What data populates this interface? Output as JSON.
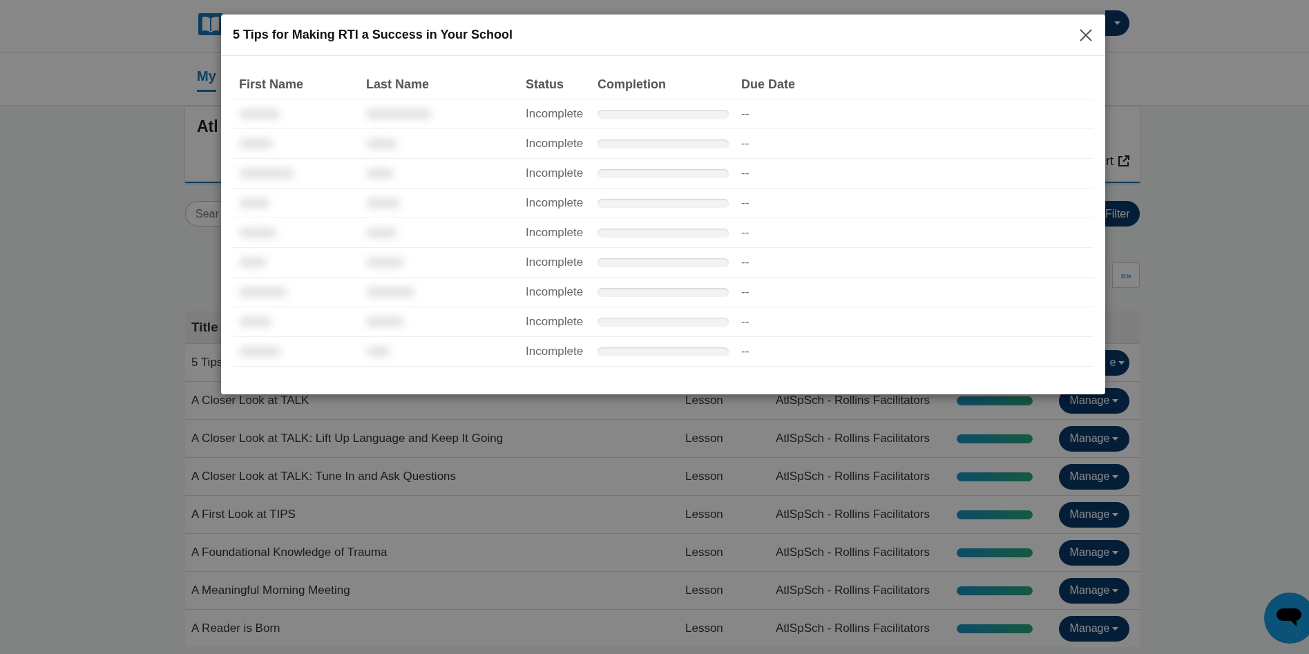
{
  "nav_tabs": [
    {
      "label": "My",
      "selected": true
    }
  ],
  "card": {
    "title": "Atl",
    "link": "rt"
  },
  "search": {
    "placeholder": "Sear"
  },
  "filter_button": "Filter",
  "pagination": {
    "last": "»»"
  },
  "table": {
    "columns": [
      "Title"
    ],
    "rows": [
      {
        "title": "5 Tips",
        "manage": "e"
      },
      {
        "title": "A Closer Look at TALK",
        "type": "Lesson",
        "group": "AtlSpSch - Rollins Facilitators",
        "level": 1,
        "manage": "Manage"
      },
      {
        "title": "A Closer Look at TALK: Lift Up Language and Keep It Going",
        "type": "Lesson",
        "group": "AtlSpSch - Rollins Facilitators",
        "level": 1,
        "manage": "Manage"
      },
      {
        "title": "A Closer Look at TALK: Tune In and Ask Questions",
        "type": "Lesson",
        "group": "AtlSpSch - Rollins Facilitators",
        "level": 1,
        "manage": "Manage"
      },
      {
        "title": "A First Look at TIPS",
        "type": "Lesson",
        "group": "AtlSpSch - Rollins Facilitators",
        "level": 1,
        "manage": "Manage"
      },
      {
        "title": "A Foundational Knowledge of Trauma",
        "type": "Lesson",
        "group": "AtlSpSch - Rollins Facilitators",
        "level": 1,
        "manage": "Manage"
      },
      {
        "title": "A Meaningful Morning Meeting",
        "type": "Lesson",
        "group": "AtlSpSch - Rollins Facilitators",
        "level": 1,
        "manage": "Manage"
      },
      {
        "title": "A Reader is Born",
        "type": "Lesson",
        "group": "AtlSpSch - Rollins Facilitators",
        "level": 1,
        "manage": "Manage"
      }
    ]
  },
  "modal": {
    "title": "5 Tips for Making RTI a Success in Your School",
    "columns": [
      "First Name",
      "Last Name",
      "Status",
      "Completion",
      "Due Date"
    ],
    "rows": [
      {
        "status": "Incomplete",
        "level": 0,
        "due_date": "--"
      },
      {
        "status": "Incomplete",
        "level": 0,
        "due_date": "--"
      },
      {
        "status": "Incomplete",
        "level": 0,
        "due_date": "--"
      },
      {
        "status": "Incomplete",
        "level": 0,
        "due_date": "--"
      },
      {
        "status": "Incomplete",
        "level": 0,
        "due_date": "--"
      },
      {
        "status": "Incomplete",
        "level": 0,
        "due_date": "--"
      },
      {
        "status": "Incomplete",
        "level": 0,
        "due_date": "--"
      },
      {
        "status": "Incomplete",
        "level": 0,
        "due_date": "--"
      },
      {
        "status": "Incomplete",
        "level": 0,
        "due_date": "--"
      }
    ]
  }
}
